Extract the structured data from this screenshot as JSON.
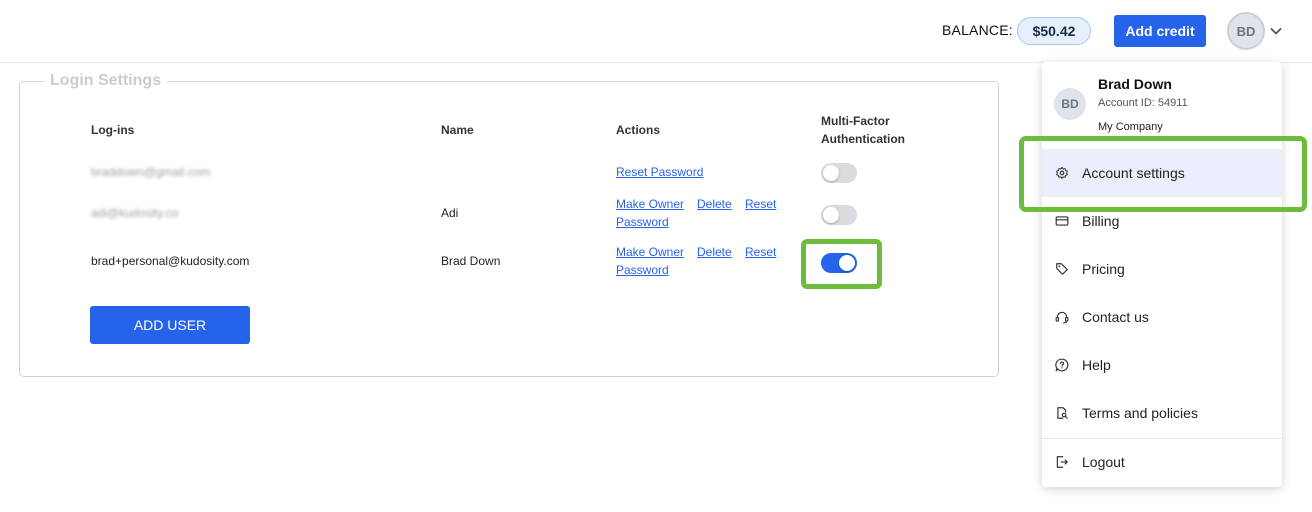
{
  "header": {
    "balance_label": "BALANCE:",
    "balance_value": "$50.42",
    "add_credit_label": "Add credit",
    "avatar_initials": "BD"
  },
  "login_settings": {
    "title": "Login Settings",
    "columns": {
      "logins": "Log-ins",
      "name": "Name",
      "actions": "Actions",
      "mfa_line1": "Multi-Factor",
      "mfa_line2": "Authentication"
    },
    "rows": [
      {
        "login": "braddown@gmail.com",
        "name": "",
        "actions": [
          "Reset Password"
        ],
        "mfa_enabled": false
      },
      {
        "login": "adi@kudosity.co",
        "name": "Adi",
        "actions": [
          "Make Owner",
          "Delete",
          "Reset",
          "Password"
        ],
        "mfa_enabled": false
      },
      {
        "login": "brad+personal@kudosity.com",
        "name": "Brad Down",
        "actions": [
          "Make Owner",
          "Delete",
          "Reset",
          "Password"
        ],
        "mfa_enabled": true
      }
    ],
    "add_user_label": "ADD USER"
  },
  "account_menu": {
    "avatar_initials": "BD",
    "user_name": "Brad Down",
    "account_id": "Account ID: 54911",
    "company": "My Company",
    "items": [
      {
        "label": "Account settings",
        "icon": "gear-icon",
        "active": true
      },
      {
        "label": "Billing",
        "icon": "credit-card-icon"
      },
      {
        "label": "Pricing",
        "icon": "tag-icon"
      },
      {
        "label": "Contact us",
        "icon": "headset-icon"
      },
      {
        "label": "Help",
        "icon": "help-icon"
      },
      {
        "label": "Terms and policies",
        "icon": "document-search-icon"
      },
      {
        "label": "Logout",
        "icon": "logout-icon"
      }
    ]
  },
  "colors": {
    "primary": "#2563eb",
    "highlight": "#6dbb3f",
    "toggle_off": "#d9dbdf"
  }
}
